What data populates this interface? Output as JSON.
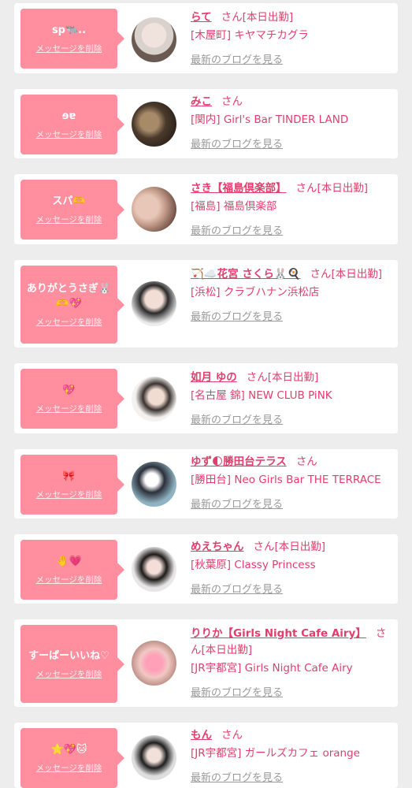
{
  "common": {
    "delete_label": "メッセージを削除",
    "blog_label": "最新のブログを見る",
    "san": "さん"
  },
  "cards": [
    {
      "message": "sp🐃..",
      "name": "らて",
      "status": "[本日出勤]",
      "shop": "[木屋町] キヤマチカグラ",
      "avatar_colors": [
        "#d9d2cc",
        "#6b5a52"
      ]
    },
    {
      "message": "ɘɐ",
      "name": "みこ",
      "status": "",
      "shop": "[関内] Girl's Bar TINDER LAND",
      "avatar_colors": [
        "#4a3a2c",
        "#a78a68"
      ]
    },
    {
      "message": "スパ🫶",
      "name": "さき【福島倶楽部】",
      "status": "[本日出勤]",
      "shop": "[福島] 福島倶楽部",
      "avatar_colors": [
        "#c9a190",
        "#5a3b30"
      ]
    },
    {
      "message": "ありがとうさぎ🐰🫶💖",
      "name": "🏹☁️花宮 さくら🐰🍳",
      "status": "[本日出勤]",
      "shop": "[浜松] クラブハナン浜松店",
      "avatar_colors": [
        "#ececec",
        "#2a2a2a"
      ]
    },
    {
      "message": "💖",
      "name": "如月 ゆの",
      "status": "[本日出勤]",
      "shop": "[名古屋 錦] NEW CLUB PiNK",
      "avatar_colors": [
        "#f4f1ee",
        "#3a3330"
      ]
    },
    {
      "message": "🎀",
      "name": "ゆず🌓勝田台テラス",
      "status": "",
      "shop": "[勝田台] Neo Girls Bar THE TERRACE",
      "avatar_colors": [
        "#8fb3c2",
        "#2b2f3a"
      ]
    },
    {
      "message": "🤚💗",
      "name": "めえちゃん",
      "status": "[本日出勤]",
      "shop": "[秋葉原] Classy Princess",
      "avatar_colors": [
        "#e8e6e6",
        "#1d1a1a"
      ]
    },
    {
      "message": "すーぱーいいね♡",
      "name": "りりか【Girls Night Cafe Airy】",
      "status": "[本日出勤]",
      "shop": "[JR宇都宮] Girls Night Cafe Airy",
      "avatar_colors": [
        "#f1c8c4",
        "#9a6a5c"
      ]
    },
    {
      "message": "⭐💖🐱",
      "name": "もん",
      "status": "",
      "shop": "[JR宇都宮] ガールズカフェ orange",
      "avatar_colors": [
        "#dedede",
        "#1f1f1f"
      ]
    }
  ]
}
